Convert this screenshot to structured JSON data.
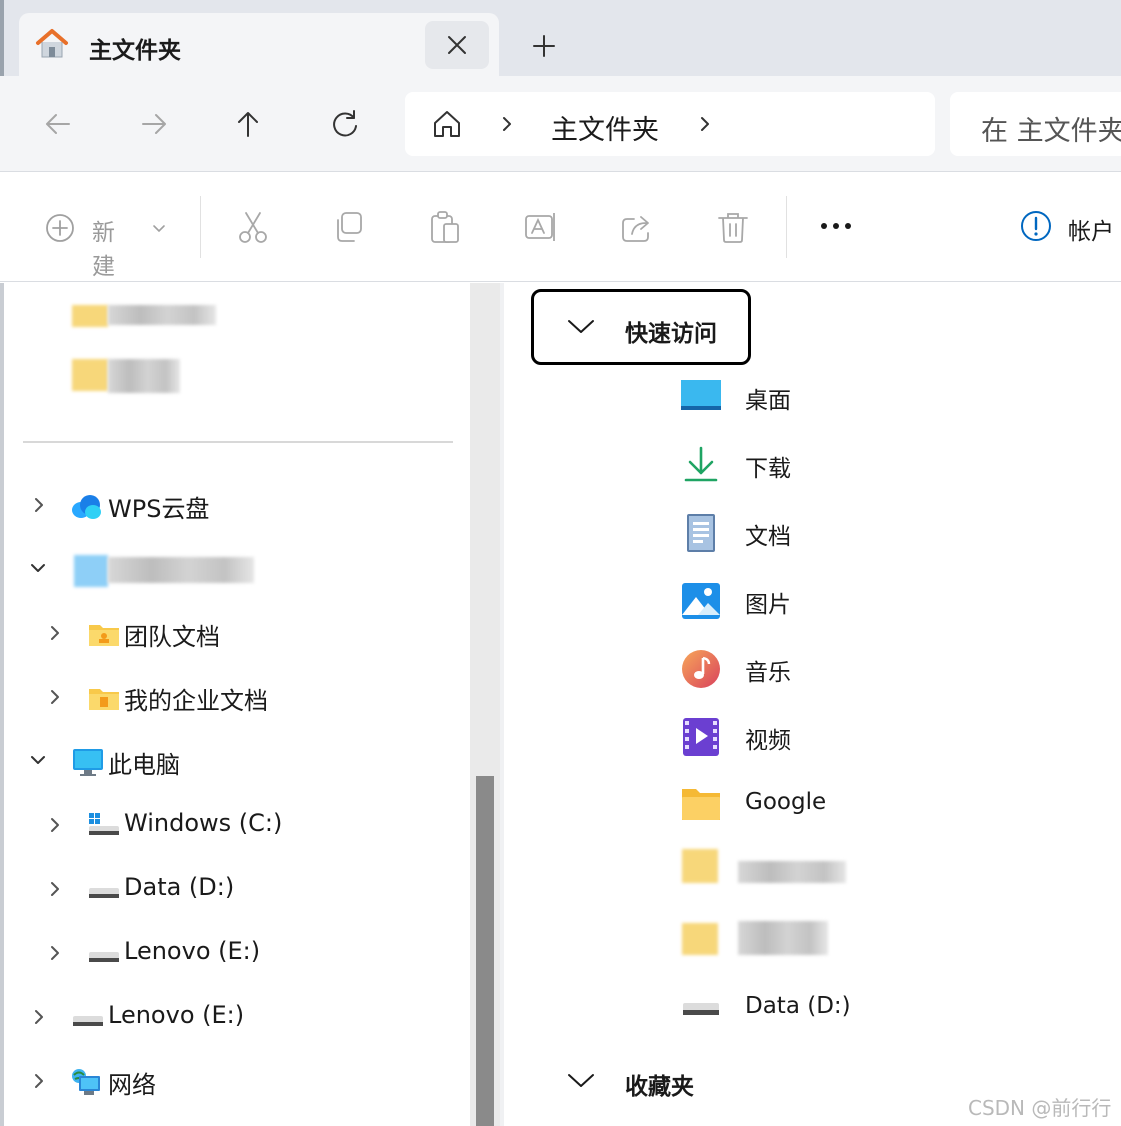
{
  "tab": {
    "title": "主文件夹"
  },
  "address": {
    "crumb": "主文件夹",
    "search_placeholder": "在 主文件夹"
  },
  "command_bar": {
    "new_label": "新建",
    "account_label": "帐户"
  },
  "sidebar": {
    "items": [
      {
        "label": "WPS云盘",
        "icon": "wps-cloud-icon",
        "expanded": false
      },
      {
        "label": "团队文档",
        "icon": "team-folder-icon",
        "expanded": false
      },
      {
        "label": "我的企业文档",
        "icon": "enterprise-folder-icon",
        "expanded": false
      },
      {
        "label": "此电脑",
        "icon": "this-pc-icon",
        "expanded": true
      },
      {
        "label": "Windows (C:)",
        "icon": "windows-drive-icon",
        "expanded": false
      },
      {
        "label": "Data (D:)",
        "icon": "drive-icon",
        "expanded": false
      },
      {
        "label": "Lenovo  (E:)",
        "icon": "drive-icon",
        "expanded": false
      },
      {
        "label": "Lenovo  (E:)",
        "icon": "drive-icon",
        "expanded": false
      },
      {
        "label": "网络",
        "icon": "network-icon",
        "expanded": false
      }
    ]
  },
  "content": {
    "quick_access_title": "快速访问",
    "favorites_title": "收藏夹",
    "items": [
      {
        "label": "桌面",
        "icon": "desktop-icon"
      },
      {
        "label": "下载",
        "icon": "download-icon"
      },
      {
        "label": "文档",
        "icon": "documents-icon"
      },
      {
        "label": "图片",
        "icon": "pictures-icon"
      },
      {
        "label": "音乐",
        "icon": "music-icon"
      },
      {
        "label": "视频",
        "icon": "videos-icon"
      },
      {
        "label": "Google",
        "icon": "folder-icon"
      },
      {
        "label": "Data (D:)",
        "icon": "drive-icon"
      }
    ]
  },
  "watermark": "CSDN @前行行",
  "colors": {
    "accent": "#0067c0",
    "folder": "#f8c94a",
    "highlight_border": "#000000"
  }
}
